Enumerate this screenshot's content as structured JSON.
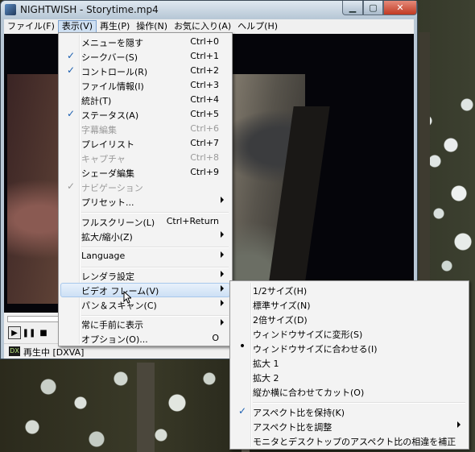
{
  "window": {
    "title": "NIGHTWISH - Storytime.mp4",
    "min_glyph": "▁",
    "max_glyph": "▢",
    "close_glyph": "✕"
  },
  "menubar": [
    {
      "label": "ファイル(F)"
    },
    {
      "label": "表示(V)"
    },
    {
      "label": "再生(P)"
    },
    {
      "label": "操作(N)"
    },
    {
      "label": "お気に入り(A)"
    },
    {
      "label": "ヘルプ(H)"
    }
  ],
  "view_menu": [
    {
      "label": "メニューを隠す",
      "shortcut": "Ctrl+0",
      "check": ""
    },
    {
      "label": "シークバー(S)",
      "shortcut": "Ctrl+1",
      "check": "✓"
    },
    {
      "label": "コントロール(R)",
      "shortcut": "Ctrl+2",
      "check": "✓"
    },
    {
      "label": "ファイル情報(I)",
      "shortcut": "Ctrl+3",
      "check": ""
    },
    {
      "label": "統計(T)",
      "shortcut": "Ctrl+4",
      "check": ""
    },
    {
      "label": "ステータス(A)",
      "shortcut": "Ctrl+5",
      "check": "✓"
    },
    {
      "label": "字幕編集",
      "shortcut": "Ctrl+6",
      "check": ""
    },
    {
      "label": "プレイリスト",
      "shortcut": "Ctrl+7",
      "check": ""
    },
    {
      "label": "キャプチャ",
      "shortcut": "Ctrl+8",
      "check": ""
    },
    {
      "label": "シェーダ編集",
      "shortcut": "Ctrl+9",
      "check": ""
    },
    {
      "label": "ナビゲーション",
      "shortcut": "",
      "check": "✓"
    },
    {
      "label": "プリセット...",
      "shortcut": "",
      "check": ""
    },
    {
      "label": "フルスクリーン(L)",
      "shortcut": "Ctrl+Return",
      "check": ""
    },
    {
      "label": "拡大/縮小(Z)",
      "shortcut": "",
      "check": ""
    },
    {
      "label": "Language",
      "shortcut": "",
      "check": ""
    },
    {
      "label": "レンダラ設定",
      "shortcut": "",
      "check": ""
    },
    {
      "label": "ビデオ フレーム(V)",
      "shortcut": "",
      "check": ""
    },
    {
      "label": "パン＆スキャン(C)",
      "shortcut": "",
      "check": ""
    },
    {
      "label": "常に手前に表示",
      "shortcut": "",
      "check": ""
    },
    {
      "label": "オプション(O)...",
      "shortcut": "O",
      "check": ""
    }
  ],
  "video_frame_menu": [
    {
      "label": "1/2サイズ(H)",
      "check": ""
    },
    {
      "label": "標準サイズ(N)",
      "check": ""
    },
    {
      "label": "2倍サイズ(D)",
      "check": ""
    },
    {
      "label": "ウィンドウサイズに変形(S)",
      "check": ""
    },
    {
      "label": "ウィンドウサイズに合わせる(I)",
      "check": "•"
    },
    {
      "label": "拡大 1",
      "check": ""
    },
    {
      "label": "拡大 2",
      "check": ""
    },
    {
      "label": "縦か横に合わせてカット(O)",
      "check": ""
    },
    {
      "label": "アスペクト比を保持(K)",
      "check": "✓"
    },
    {
      "label": "アスペクト比を調整",
      "check": ""
    },
    {
      "label": "モニタとデスクトップのアスペクト比の相違を補正",
      "check": ""
    }
  ],
  "controls": {
    "play_glyph": "▶",
    "pause_glyph": "❚❚",
    "stop_glyph": "■"
  },
  "status": {
    "icon_text": "DX",
    "text": "再生中 [DXVA]"
  }
}
